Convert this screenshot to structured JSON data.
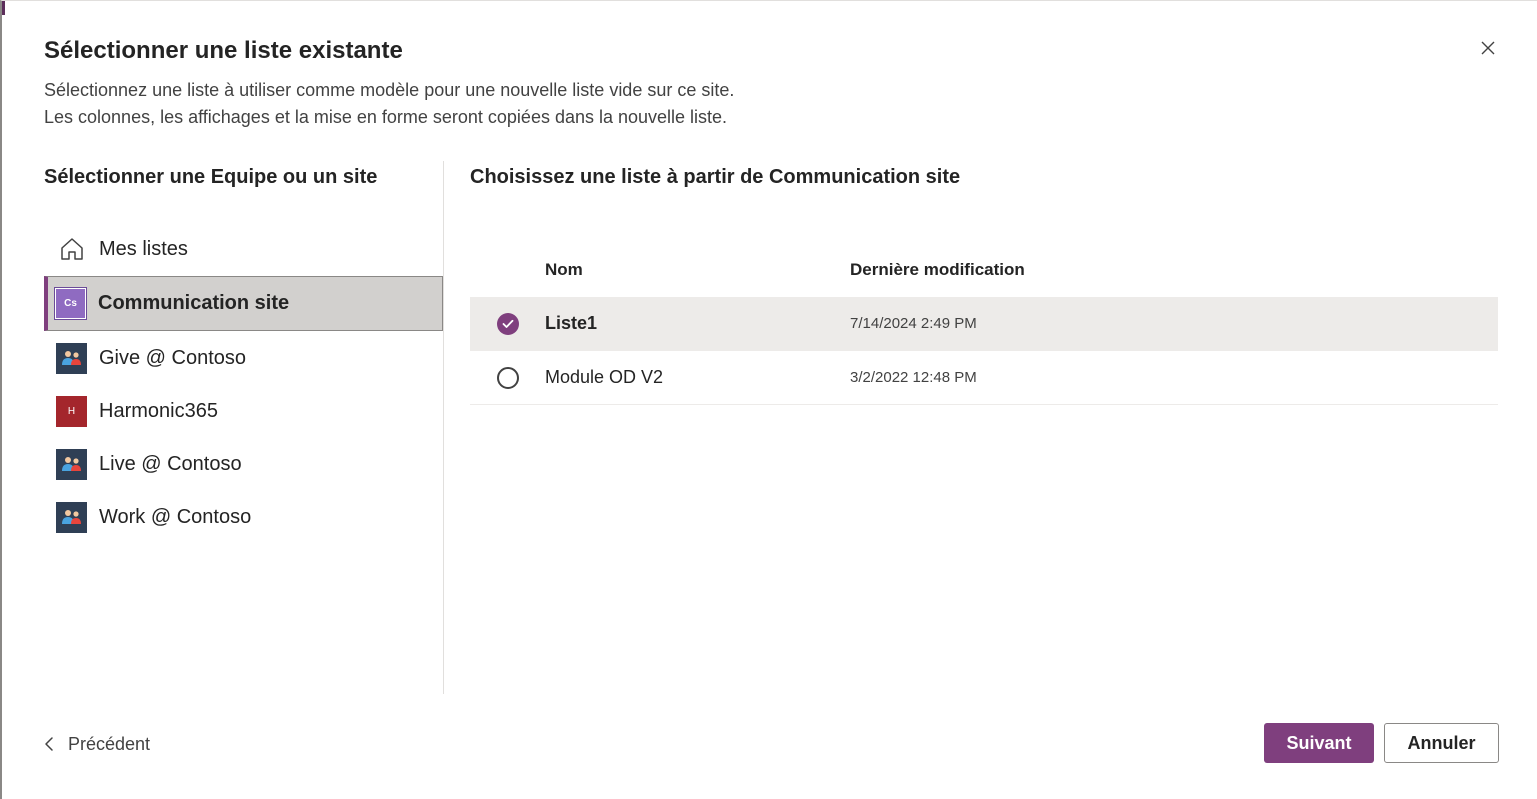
{
  "dialog": {
    "title": "Sélectionner une liste existante",
    "description_line1": "Sélectionnez une liste à utiliser comme modèle pour une nouvelle liste vide sur ce site.",
    "description_line2": "Les colonnes, les affichages et la mise en forme seront copiées dans la nouvelle liste.",
    "close_icon": "close-icon"
  },
  "left_panel": {
    "heading": "Sélectionner une Equipe ou un site",
    "items": [
      {
        "label": "Mes listes",
        "icon": "home-icon",
        "selected": false
      },
      {
        "label": "Communication site",
        "icon_text": "Cs",
        "icon_color": "#8f6bc1",
        "selected": true
      },
      {
        "label": "Give @ Contoso",
        "icon": "team-icon",
        "selected": false
      },
      {
        "label": "Harmonic365",
        "icon_text": "H",
        "icon_color": "#a4262c",
        "selected": false
      },
      {
        "label": "Live @ Contoso",
        "icon": "team-icon",
        "selected": false
      },
      {
        "label": "Work @ Contoso",
        "icon": "team-icon",
        "selected": false
      }
    ]
  },
  "right_panel": {
    "heading": "Choisissez une liste à partir de Communication site",
    "columns": {
      "name": "Nom",
      "modified": "Dernière modification"
    },
    "rows": [
      {
        "name": "Liste1",
        "modified": "7/14/2024 2:49 PM",
        "selected": true
      },
      {
        "name": "Module OD V2",
        "modified": "3/2/2022 12:48 PM",
        "selected": false
      }
    ]
  },
  "footer": {
    "previous_label": "Précédent",
    "next_label": "Suivant",
    "cancel_label": "Annuler"
  },
  "colors": {
    "accent": "#7f3f7e",
    "selected_bg": "#d2d0ce",
    "row_selected_bg": "#edebe9"
  }
}
